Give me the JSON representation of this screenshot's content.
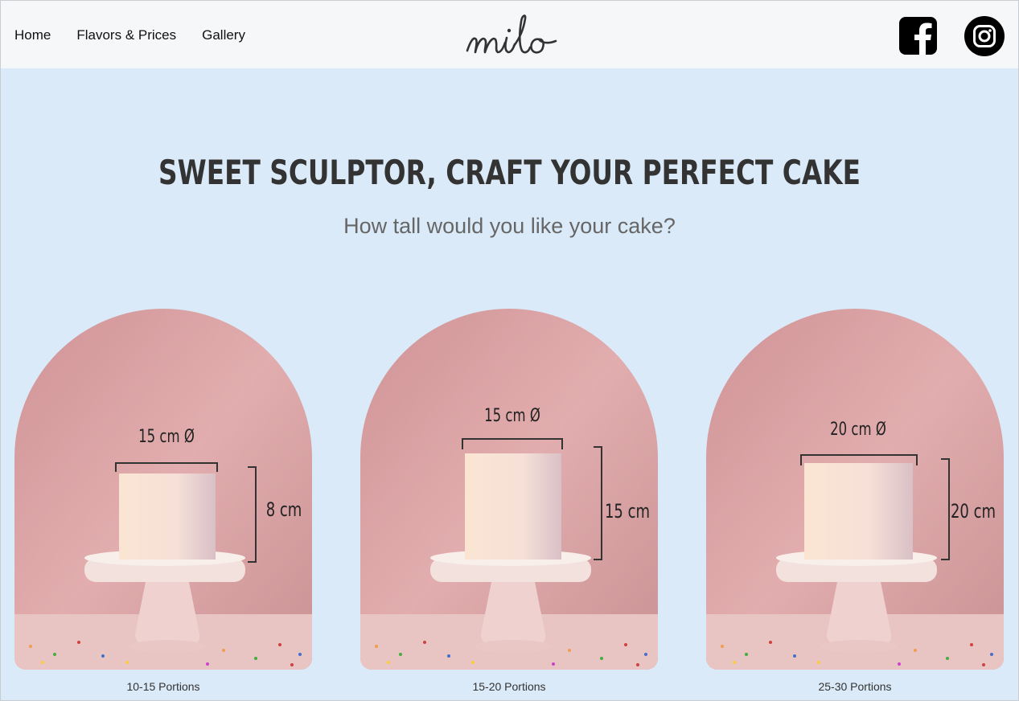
{
  "nav": {
    "items": [
      {
        "label": "Home"
      },
      {
        "label": "Flavors & Prices"
      },
      {
        "label": "Gallery"
      }
    ]
  },
  "brand": {
    "logo_text": "milo"
  },
  "social": {
    "icons": [
      "facebook-icon",
      "instagram-icon"
    ]
  },
  "hero": {
    "title": "SWEET SCULPTOR, CRAFT YOUR PERFECT CAKE",
    "subtitle": "How tall would you like your cake?"
  },
  "options": [
    {
      "diameter_label": "15 cm Ø",
      "height_label": "8 cm",
      "caption": "10-15 Portions"
    },
    {
      "diameter_label": "15 cm Ø",
      "height_label": "15 cm",
      "caption": "15-20 Portions"
    },
    {
      "diameter_label": "20 cm Ø",
      "height_label": "20 cm",
      "caption": "25-30 Portions"
    }
  ],
  "colors": {
    "page_bg": "#dbeaf8",
    "header_bg": "#f6f7f9",
    "card_bg": "#dca3a6",
    "cake": "#f6e3d6"
  }
}
